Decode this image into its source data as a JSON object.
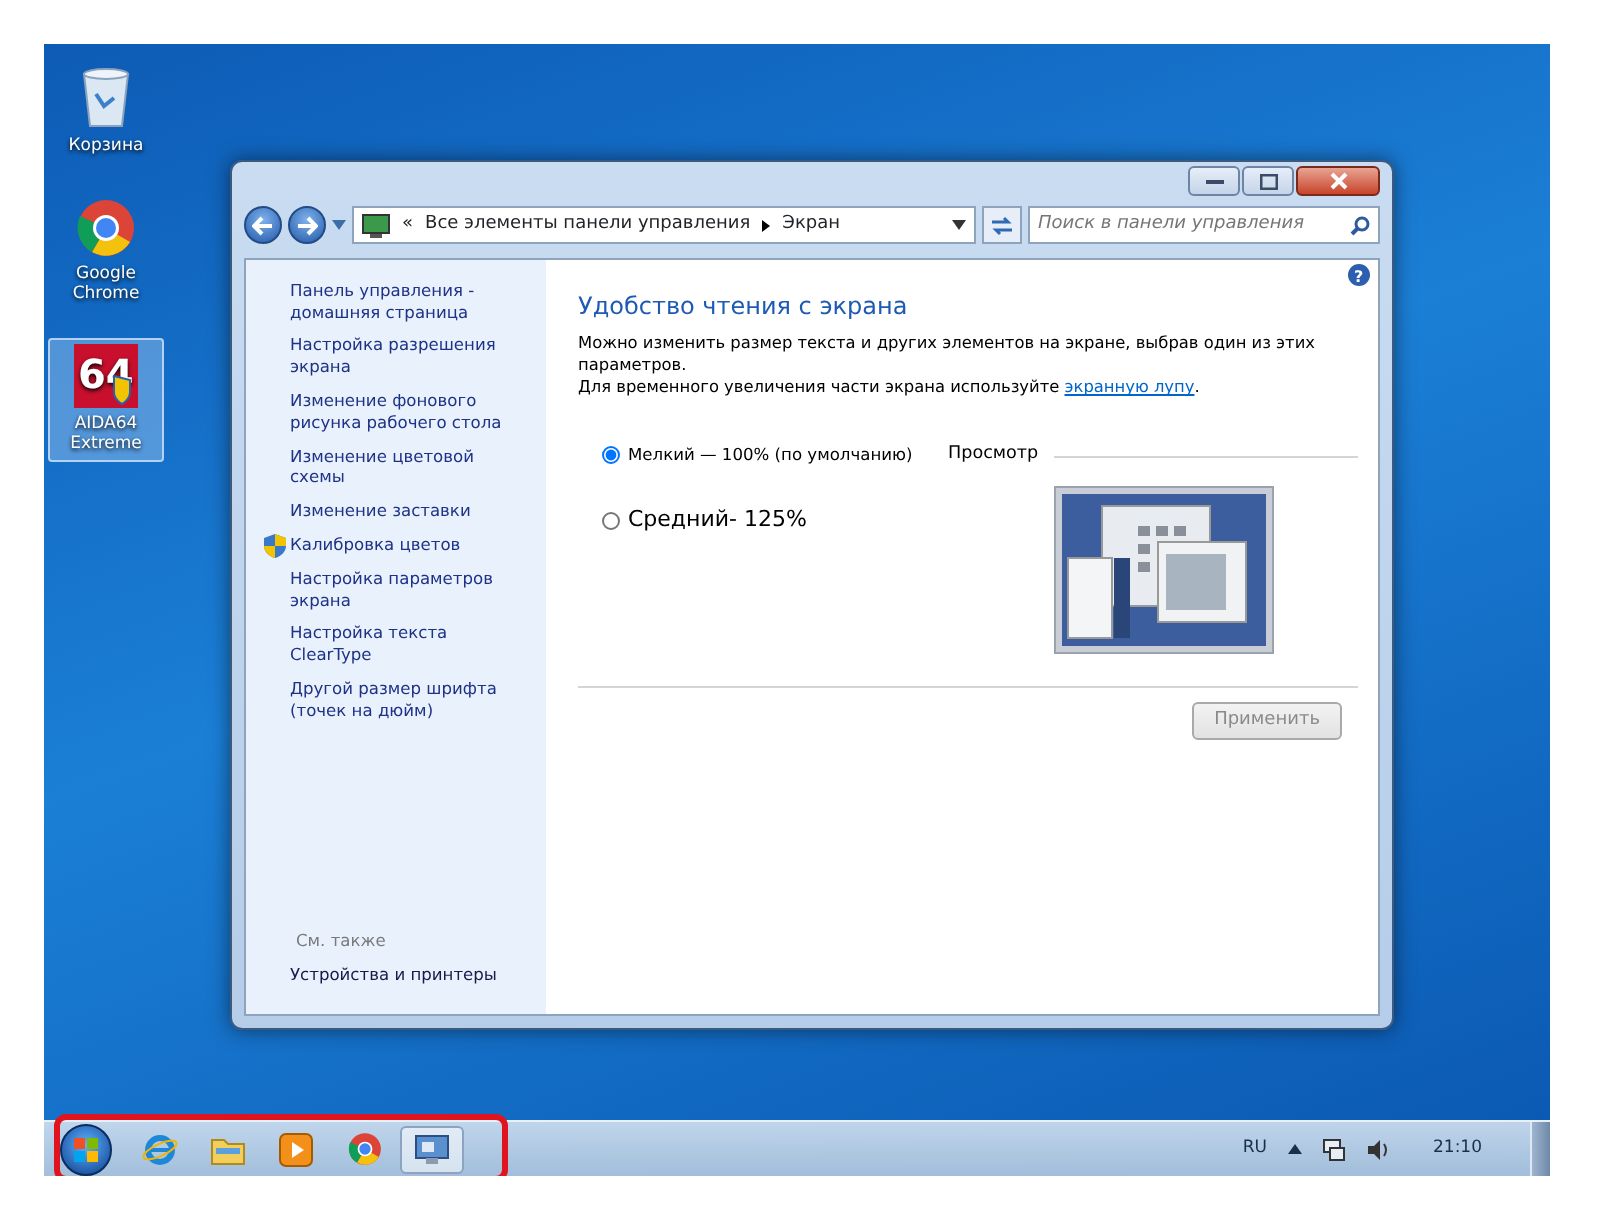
{
  "desktop_icons": [
    {
      "label": "Корзина",
      "kind": "bin",
      "selected": false
    },
    {
      "label": "Google Chrome",
      "kind": "chrome",
      "selected": false
    },
    {
      "label": "AIDA64 Extreme",
      "kind": "aida",
      "selected": true,
      "badge": "64"
    }
  ],
  "window": {
    "address": {
      "overflow": "«",
      "path": [
        "Все элементы панели управления",
        "Экран"
      ]
    },
    "search": {
      "placeholder": "Поиск в панели управления"
    },
    "sidebar": {
      "items": [
        {
          "label": "Панель управления - домашняя страница",
          "shield": false
        },
        {
          "label": "Настройка разрешения экрана",
          "shield": false
        },
        {
          "label": "Изменение фонового рисунка рабочего стола",
          "shield": false
        },
        {
          "label": "Изменение цветовой схемы",
          "shield": false
        },
        {
          "label": "Изменение заставки",
          "shield": false
        },
        {
          "label": "Калибровка цветов",
          "shield": true
        },
        {
          "label": "Настройка параметров экрана",
          "shield": false
        },
        {
          "label": "Настройка текста ClearType",
          "shield": false
        },
        {
          "label": "Другой размер шрифта (точек на дюйм)",
          "shield": false
        }
      ],
      "see_also": {
        "title": "См. также",
        "items": [
          "Устройства и принтеры"
        ]
      }
    },
    "help": "?",
    "heading": "Удобство чтения с экрана",
    "description": {
      "lines": [
        "Можно изменить размер текста и других элементов на экране, выбрав один из этих параметров.",
        "Для временного увеличения части экрана используйте"
      ],
      "link": "экранную лупу",
      "after": "."
    },
    "options": [
      {
        "label": "Мелкий — 100% (по умолчанию)",
        "selected": true,
        "kind": "small"
      },
      {
        "label": "Средний- 125%",
        "selected": false,
        "kind": "large"
      }
    ],
    "preview_label": "Просмотр",
    "apply_button": {
      "label": "Применить",
      "disabled": true
    }
  },
  "taskbar": {
    "items": [
      {
        "kind": "ie",
        "selected": false
      },
      {
        "kind": "folder",
        "selected": false
      },
      {
        "kind": "player",
        "selected": false
      },
      {
        "kind": "chrome",
        "selected": false
      },
      {
        "kind": "display",
        "selected": true
      }
    ],
    "language": "RU",
    "clock": "21:10"
  }
}
